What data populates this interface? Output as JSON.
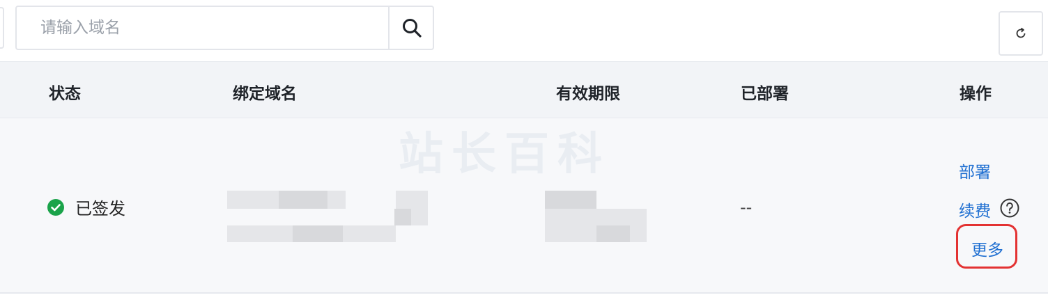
{
  "search": {
    "placeholder": "请输入域名"
  },
  "table": {
    "headers": {
      "status": "状态",
      "domain": "绑定域名",
      "validity": "有效期限",
      "deployed": "已部署",
      "actions": "操作"
    },
    "rows": [
      {
        "status": "已签发",
        "deployed": "--",
        "actions": {
          "deploy": "部署",
          "renew": "续费",
          "more": "更多"
        }
      }
    ]
  },
  "colors": {
    "link": "#1f6fd1",
    "success": "#1aa34a",
    "highlight": "#e33232",
    "header_bg": "#f2f4f7"
  },
  "icons": {
    "search": "search-icon",
    "refresh": "refresh-icon",
    "status": "check-circle-icon",
    "help": "help-circle-icon"
  }
}
